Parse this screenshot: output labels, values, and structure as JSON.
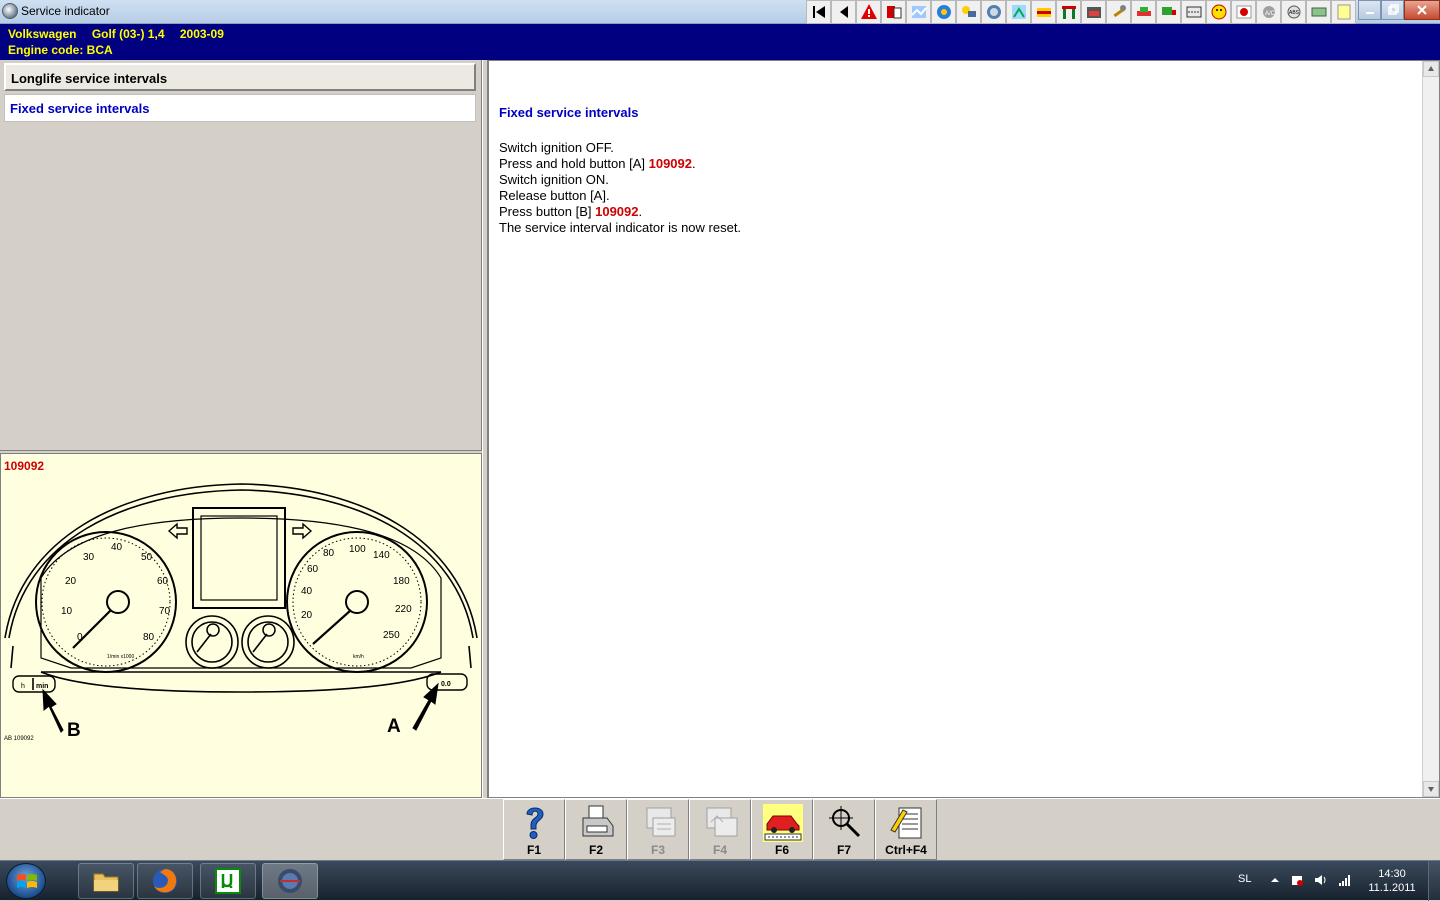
{
  "window": {
    "title": "Service indicator"
  },
  "vehicle": {
    "make": "Volkswagen",
    "model": "Golf (03-) 1,4",
    "date": "2003-09",
    "engine_code": "Engine code: BCA"
  },
  "nav": {
    "items": [
      {
        "label": "Longlife service intervals"
      },
      {
        "label": "Fixed service intervals"
      }
    ]
  },
  "figure": {
    "number": "109092",
    "code": "AB 109092",
    "label_a": "A",
    "label_b": "B",
    "button_b_left": "h",
    "button_b_right": "min",
    "button_a": "0.0",
    "speedo_unit": "km/h",
    "tacho_unit": "1/min x1000",
    "tacho_ticks": [
      "0",
      "10",
      "20",
      "30",
      "40",
      "50",
      "60",
      "70",
      "80"
    ],
    "speedo_ticks": [
      "20",
      "40",
      "60",
      "80",
      "100",
      "140",
      "180",
      "220",
      "250"
    ]
  },
  "content": {
    "heading": "Fixed service intervals",
    "steps": [
      {
        "text": "Switch ignition OFF."
      },
      {
        "text": "Press and hold button [A] ",
        "ref": "109092",
        "after": "."
      },
      {
        "text": "Switch ignition ON."
      },
      {
        "text": "Release button [A]."
      },
      {
        "text": "Press button [B] ",
        "ref": "109092",
        "after": "."
      },
      {
        "text": "The service interval indicator is now reset."
      }
    ]
  },
  "function_keys": [
    {
      "label": "F1",
      "icon": "help-icon",
      "enabled": true
    },
    {
      "label": "F2",
      "icon": "printer-icon",
      "enabled": true
    },
    {
      "label": "F3",
      "icon": "notes-icon",
      "enabled": false
    },
    {
      "label": "F4",
      "icon": "notes-image-icon",
      "enabled": false
    },
    {
      "label": "F6",
      "icon": "car-vin-icon",
      "enabled": true
    },
    {
      "label": "F7",
      "icon": "search-magnifier-icon",
      "enabled": true
    },
    {
      "label": "Ctrl+F4",
      "icon": "notepad-edit-icon",
      "enabled": true
    }
  ],
  "taskbar": {
    "language": "SL",
    "time": "14:30",
    "date": "11.1.2011"
  },
  "colors": {
    "vehicle_bar_bg": "#000080",
    "vehicle_bar_text": "#ffff00",
    "link_blue": "#0000c0",
    "ref_red": "#d00000",
    "figure_bg": "#ffffe0"
  }
}
